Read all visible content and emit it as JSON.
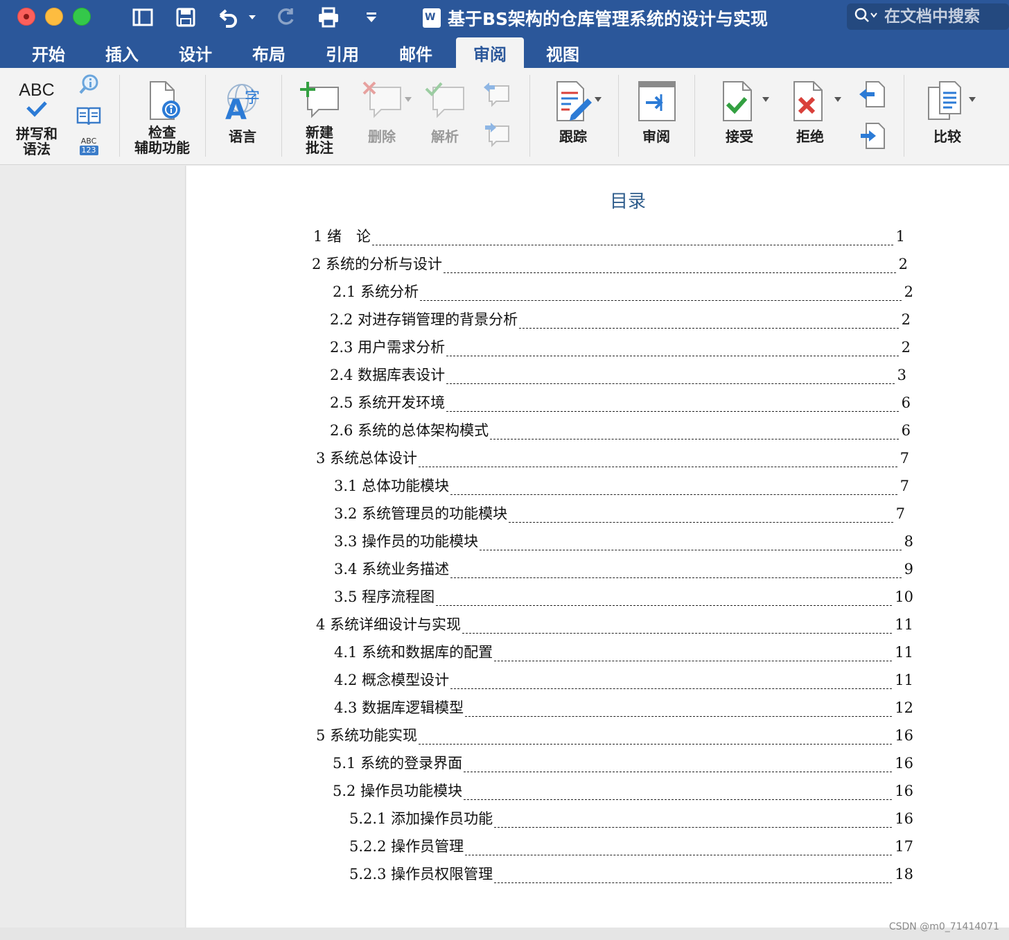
{
  "window": {
    "title": "基于BS架构的仓库管理系统的设计与实现",
    "search_placeholder": "在文档中搜索"
  },
  "tabs": [
    "开始",
    "插入",
    "设计",
    "布局",
    "引用",
    "邮件",
    "审阅",
    "视图"
  ],
  "active_tab": "审阅",
  "ribbon": {
    "spelling": [
      "拼写和",
      "语法"
    ],
    "abc_label": "ABC",
    "abc_small": "ABC",
    "abc_123": "123",
    "accessibility": [
      "检查",
      "辅助功能"
    ],
    "language": "语言",
    "new_comment": [
      "新建",
      "批注"
    ],
    "delete": "删除",
    "resolve": "解析",
    "track": "跟踪",
    "review": "审阅",
    "accept": "接受",
    "reject": "拒绝",
    "compare": "比较"
  },
  "document": {
    "toc_title": "目录",
    "toc": [
      {
        "text": "1 绪　论",
        "page": "1"
      },
      {
        "text": "2 系统的分析与设计",
        "page": "2"
      },
      {
        "text": "2.1 系统分析",
        "page": "2"
      },
      {
        "text": "2.2 对进存销管理的背景分析",
        "page": "2"
      },
      {
        "text": "2.3 用户需求分析",
        "page": "2"
      },
      {
        "text": "2.4  数据库表设计",
        "page": "3"
      },
      {
        "text": "2.5 系统开发环境",
        "page": "6"
      },
      {
        "text": "2.6 系统的总体架构模式",
        "page": "6"
      },
      {
        "text": "3  系统总体设计",
        "page": "7"
      },
      {
        "text": "3.1  总体功能模块",
        "page": "7"
      },
      {
        "text": "3.2 系统管理员的功能模块",
        "page": "7"
      },
      {
        "text": "3.3 操作员的功能模块",
        "page": "8"
      },
      {
        "text": "3.4 系统业务描述",
        "page": "9"
      },
      {
        "text": "3.5 程序流程图",
        "page": "10"
      },
      {
        "text": "4 系统详细设计与实现",
        "page": "11"
      },
      {
        "text": "4.1 系统和数据库的配置",
        "page": "11"
      },
      {
        "text": "4.2 概念模型设计",
        "page": "11"
      },
      {
        "text": "4.3 数据库逻辑模型",
        "page": "12"
      },
      {
        "text": "5 系统功能实现",
        "page": "16"
      },
      {
        "text": "5.1 系统的登录界面",
        "page": "16"
      },
      {
        "text": "5.2 操作员功能模块",
        "page": "16"
      },
      {
        "text": "5.2.1 添加操作员功能",
        "page": "16"
      },
      {
        "text": "5.2.2 操作员管理",
        "page": "17"
      },
      {
        "text": "5.2.3 操作员权限管理",
        "page": "18"
      }
    ]
  },
  "watermark": "CSDN @m0_71414071",
  "colors": {
    "accent": "#2b579a",
    "toc_title": "#2f5d8c"
  }
}
